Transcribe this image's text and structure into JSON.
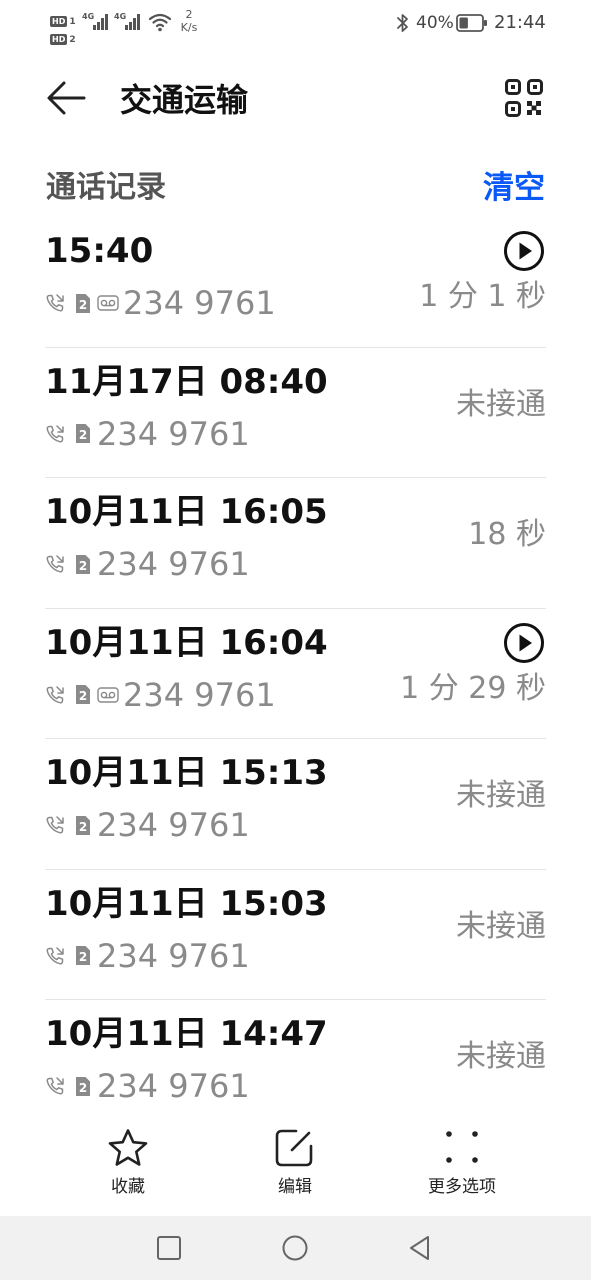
{
  "status_bar": {
    "sim1_tag": "HD",
    "sim1_num": "1",
    "sim2_tag": "HD",
    "sim2_num": "2",
    "signal1_label": "4G",
    "signal2_label": "4G",
    "speed_value": "2",
    "speed_unit": "K/s",
    "battery_percent": "40%",
    "battery_level": 0.4,
    "time": "21:44"
  },
  "header": {
    "title": "交通运输",
    "back_icon": "back-arrow-icon",
    "qr_icon": "qr-code-icon"
  },
  "section": {
    "title": "通话记录",
    "clear_label": "清空",
    "accent_color": "#0a59f7"
  },
  "calls": [
    {
      "datetime": "15:40",
      "number": "234 9761",
      "status": "1 分 1 秒",
      "has_recording": true
    },
    {
      "datetime": "11月17日 08:40",
      "number": "234 9761",
      "status": "未接通",
      "has_recording": false
    },
    {
      "datetime": "10月11日 16:05",
      "number": "234 9761",
      "status": "18 秒",
      "has_recording": false
    },
    {
      "datetime": "10月11日 16:04",
      "number": "234 9761",
      "status": "1 分 29 秒",
      "has_recording": true
    },
    {
      "datetime": "10月11日 15:13",
      "number": "234 9761",
      "status": "未接通",
      "has_recording": false
    },
    {
      "datetime": "10月11日 15:03",
      "number": "234 9761",
      "status": "未接通",
      "has_recording": false
    },
    {
      "datetime": "10月11日 14:47",
      "number": "234 9761",
      "status": "未接通",
      "has_recording": false
    }
  ],
  "toolbar": {
    "favorite_label": "收藏",
    "edit_label": "编辑",
    "more_label": "更多选项"
  },
  "nav": {
    "recent_icon": "square-icon",
    "home_icon": "circle-icon",
    "back_icon": "triangle-back-icon"
  }
}
